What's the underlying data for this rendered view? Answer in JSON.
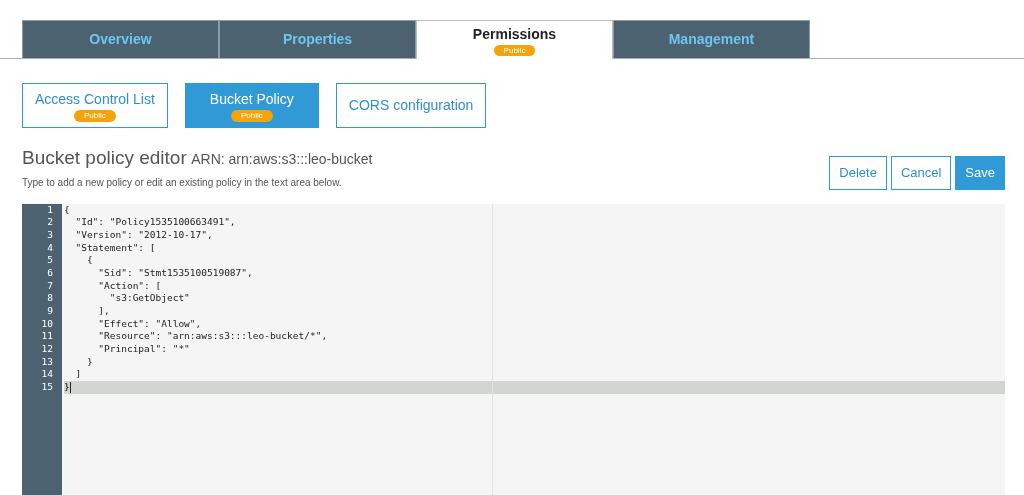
{
  "tabs": [
    {
      "label": "Overview",
      "selected": false
    },
    {
      "label": "Properties",
      "selected": false
    },
    {
      "label": "Permissions",
      "selected": true,
      "badge": "Public"
    },
    {
      "label": "Management",
      "selected": false
    }
  ],
  "subtabs": [
    {
      "label": "Access Control List",
      "selected": false,
      "badge": "Public"
    },
    {
      "label": "Bucket Policy",
      "selected": true,
      "badge": "Public"
    },
    {
      "label": "CORS configuration",
      "selected": false
    }
  ],
  "editor_header": {
    "title": "Bucket policy editor",
    "arn": "ARN: arn:aws:s3:::leo-bucket",
    "hint": "Type to add a new policy or edit an existing policy in the text area below."
  },
  "buttons": [
    {
      "label": "Delete",
      "kind": "outline"
    },
    {
      "label": "Cancel",
      "kind": "outline"
    },
    {
      "label": "Save",
      "kind": "primary"
    }
  ],
  "editor_lines": [
    {
      "number": "1",
      "text": "{",
      "active": false
    },
    {
      "number": "2",
      "text": "  \"Id\": \"Policy1535100663491\",",
      "active": false
    },
    {
      "number": "3",
      "text": "  \"Version\": \"2012-10-17\",",
      "active": false
    },
    {
      "number": "4",
      "text": "  \"Statement\": [",
      "active": false
    },
    {
      "number": "5",
      "text": "    {",
      "active": false
    },
    {
      "number": "6",
      "text": "      \"Sid\": \"Stmt1535100519087\",",
      "active": false
    },
    {
      "number": "7",
      "text": "      \"Action\": [",
      "active": false
    },
    {
      "number": "8",
      "text": "        \"s3:GetObject\"",
      "active": false
    },
    {
      "number": "9",
      "text": "      ],",
      "active": false
    },
    {
      "number": "10",
      "text": "      \"Effect\": \"Allow\",",
      "active": false
    },
    {
      "number": "11",
      "text": "      \"Resource\": \"arn:aws:s3:::leo-bucket/*\",",
      "active": false
    },
    {
      "number": "12",
      "text": "      \"Principal\": \"*\"",
      "active": false
    },
    {
      "number": "13",
      "text": "    }",
      "active": false
    },
    {
      "number": "14",
      "text": "  ]",
      "active": false
    },
    {
      "number": "15",
      "text": "}",
      "active": true
    }
  ]
}
